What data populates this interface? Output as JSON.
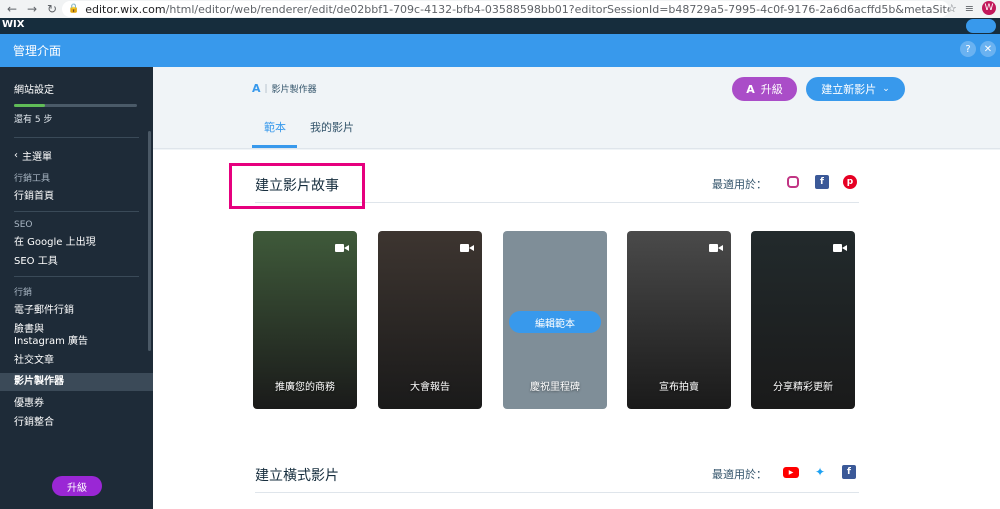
{
  "browser": {
    "url_host": "editor.wix.com",
    "url_rest": "/html/editor/web/renderer/edit/de02bbf1-709c-4132-bfb4-03588598bb01?editorSessionId=b48729a5-7995-4c0f-9176-2a6d6acffd5b&metaSiteId=11229286-d7a0-4e6d-b...",
    "profile_initial": "W"
  },
  "header": {
    "title": "管理介面",
    "help": "?",
    "close": "✕"
  },
  "sidebar": {
    "setup_title": "網站設定",
    "progress": 0.25,
    "steps_left": "還有 5 步",
    "main_menu": "主選單",
    "groups": [
      {
        "title": "行銷工具",
        "items": [
          "行銷首頁"
        ]
      },
      {
        "title": "SEO",
        "items": [
          "在 Google 上出現",
          "SEO 工具"
        ]
      },
      {
        "title": "行銷",
        "items": [
          "電子郵件行銷",
          "臉書與\nInstagram 廣告",
          "社交文章",
          "影片製作器",
          "優惠券",
          "行銷整合"
        ]
      }
    ],
    "active_item": "影片製作器",
    "upgrade": "升級"
  },
  "app": {
    "logo_mark": "A",
    "name": "影片製作器",
    "upgrade": "升級",
    "create": "建立新影片"
  },
  "tabs": {
    "templates": "範本",
    "my_videos": "我的影片"
  },
  "section1": {
    "title": "建立影片故事",
    "best_for": "最適用於：",
    "platforms": [
      "instagram-icon",
      "facebook-icon",
      "pinterest-icon"
    ]
  },
  "cards": [
    {
      "label": "推廣您的商務",
      "color": "#3f5a3a"
    },
    {
      "label": "大會報告",
      "color": "#3d3530"
    },
    {
      "label": "慶祝里程碑",
      "color": "#7f8e98",
      "button": "編輯範本"
    },
    {
      "label": "宣布拍賣",
      "color": "#4a4a4a"
    },
    {
      "label": "分享精彩更新",
      "color": "#222a2c"
    }
  ],
  "section2": {
    "title": "建立橫式影片",
    "best_for": "最適用於：",
    "platforms": [
      "youtube-icon",
      "twitter-icon",
      "facebook-icon"
    ]
  },
  "colors": {
    "accent": "#3899ec",
    "upgrade": "#aa4dc8",
    "highlight": "#e6007e",
    "sidebar": "#1e2b38"
  }
}
